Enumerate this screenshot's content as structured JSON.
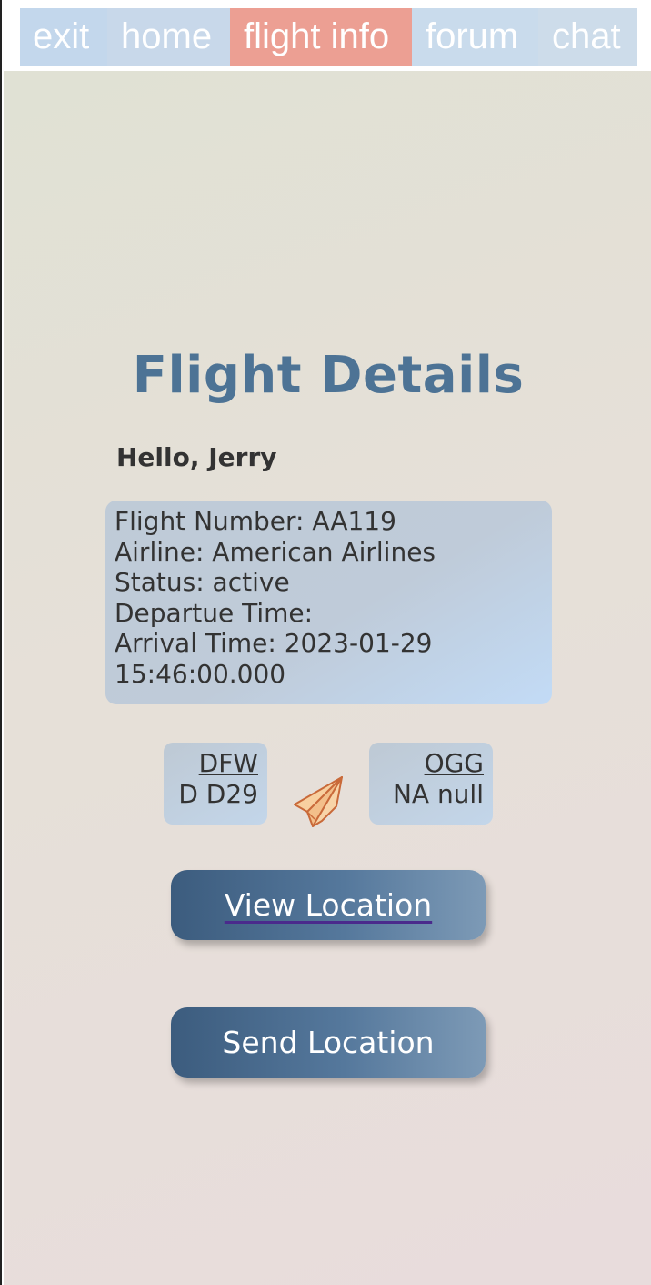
{
  "nav": {
    "tabs": [
      {
        "label": "exit"
      },
      {
        "label": "home"
      },
      {
        "label": "flight info",
        "active": true
      },
      {
        "label": "forum"
      },
      {
        "label": "chat"
      }
    ]
  },
  "main": {
    "title": "Flight Details",
    "greeting": "Hello, Jerry",
    "info": {
      "flight_number": "Flight Number: AA119",
      "airline": "Airline: American Airlines",
      "status": "Status: active",
      "departure_time": "Departue Time:",
      "arrival_time_1": "Arrival Time: 2023-01-29",
      "arrival_time_2": "15:46:00.000"
    },
    "departure": {
      "code": "DFW",
      "gate": "D D29"
    },
    "arrival": {
      "code": "OGG",
      "gate": "NA null"
    },
    "plane_icon": "paper-plane-icon",
    "view_location_label": "View Location",
    "send_location_label": "Send Location"
  },
  "colors": {
    "nav_tab": "#c3d7ec",
    "nav_tab_active": "#ec9f93",
    "title": "#4d7395",
    "button": "#4a6b8f"
  }
}
